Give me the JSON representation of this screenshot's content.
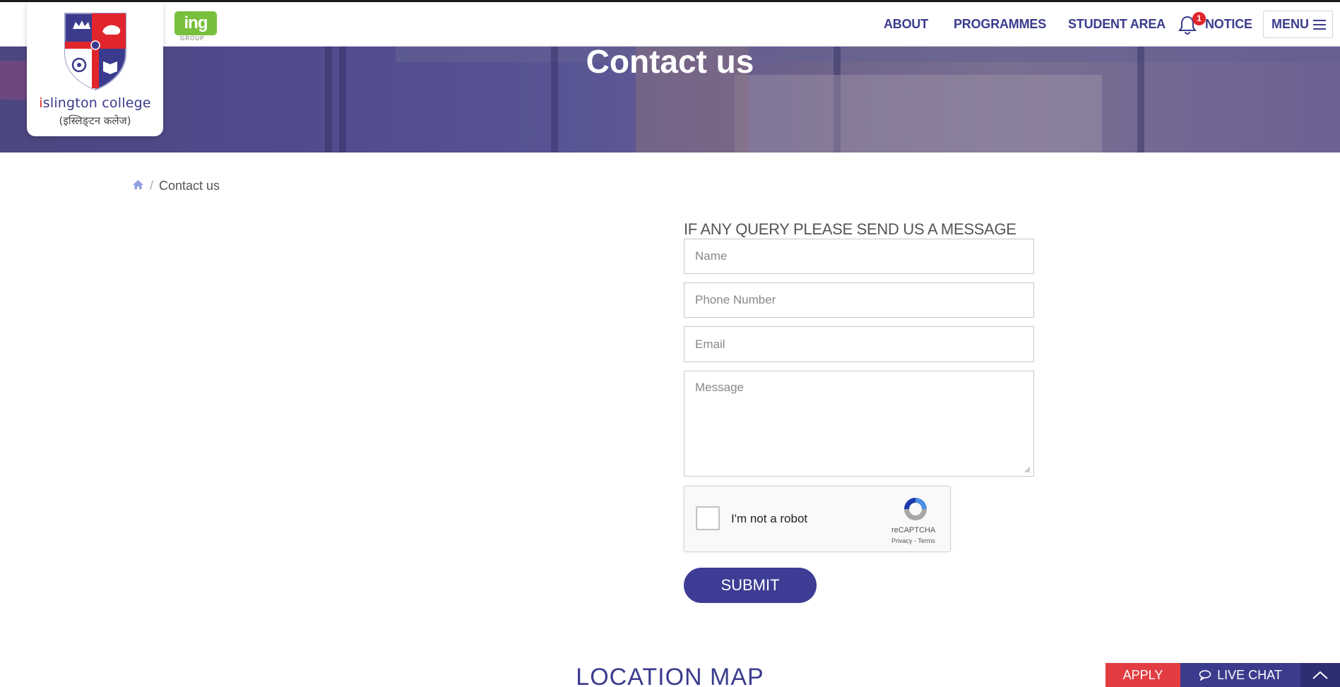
{
  "header": {
    "logo": {
      "name_i": "i",
      "name_rest": "slington college",
      "subtitle": "(इस्लिङ्टन कलेज)"
    },
    "partner_logo": {
      "text": "ing",
      "caption": "GROUP"
    },
    "nav": {
      "about": "ABOUT",
      "programmes": "PROGRAMMES",
      "student_area": "STUDENT AREA",
      "notice": "NOTICE",
      "notice_badge": "1",
      "menu": "MENU"
    }
  },
  "hero": {
    "title": "Contact us"
  },
  "breadcrumb": {
    "current": "Contact us"
  },
  "form": {
    "title": "IF ANY QUERY PLEASE SEND US A MESSAGE",
    "name_placeholder": "Name",
    "phone_placeholder": "Phone Number",
    "email_placeholder": "Email",
    "message_placeholder": "Message",
    "captcha_label": "I'm not a robot",
    "captcha_brand": "reCAPTCHA",
    "captcha_links": "Privacy - Terms",
    "submit": "SUBMIT"
  },
  "location": {
    "title": "LOCATION MAP"
  },
  "sticky": {
    "apply": "APPLY",
    "live_chat": "LIVE CHAT"
  },
  "colors": {
    "brand": "#3b3b8e",
    "accent": "#e0262c",
    "partner": "#78bf3c"
  }
}
